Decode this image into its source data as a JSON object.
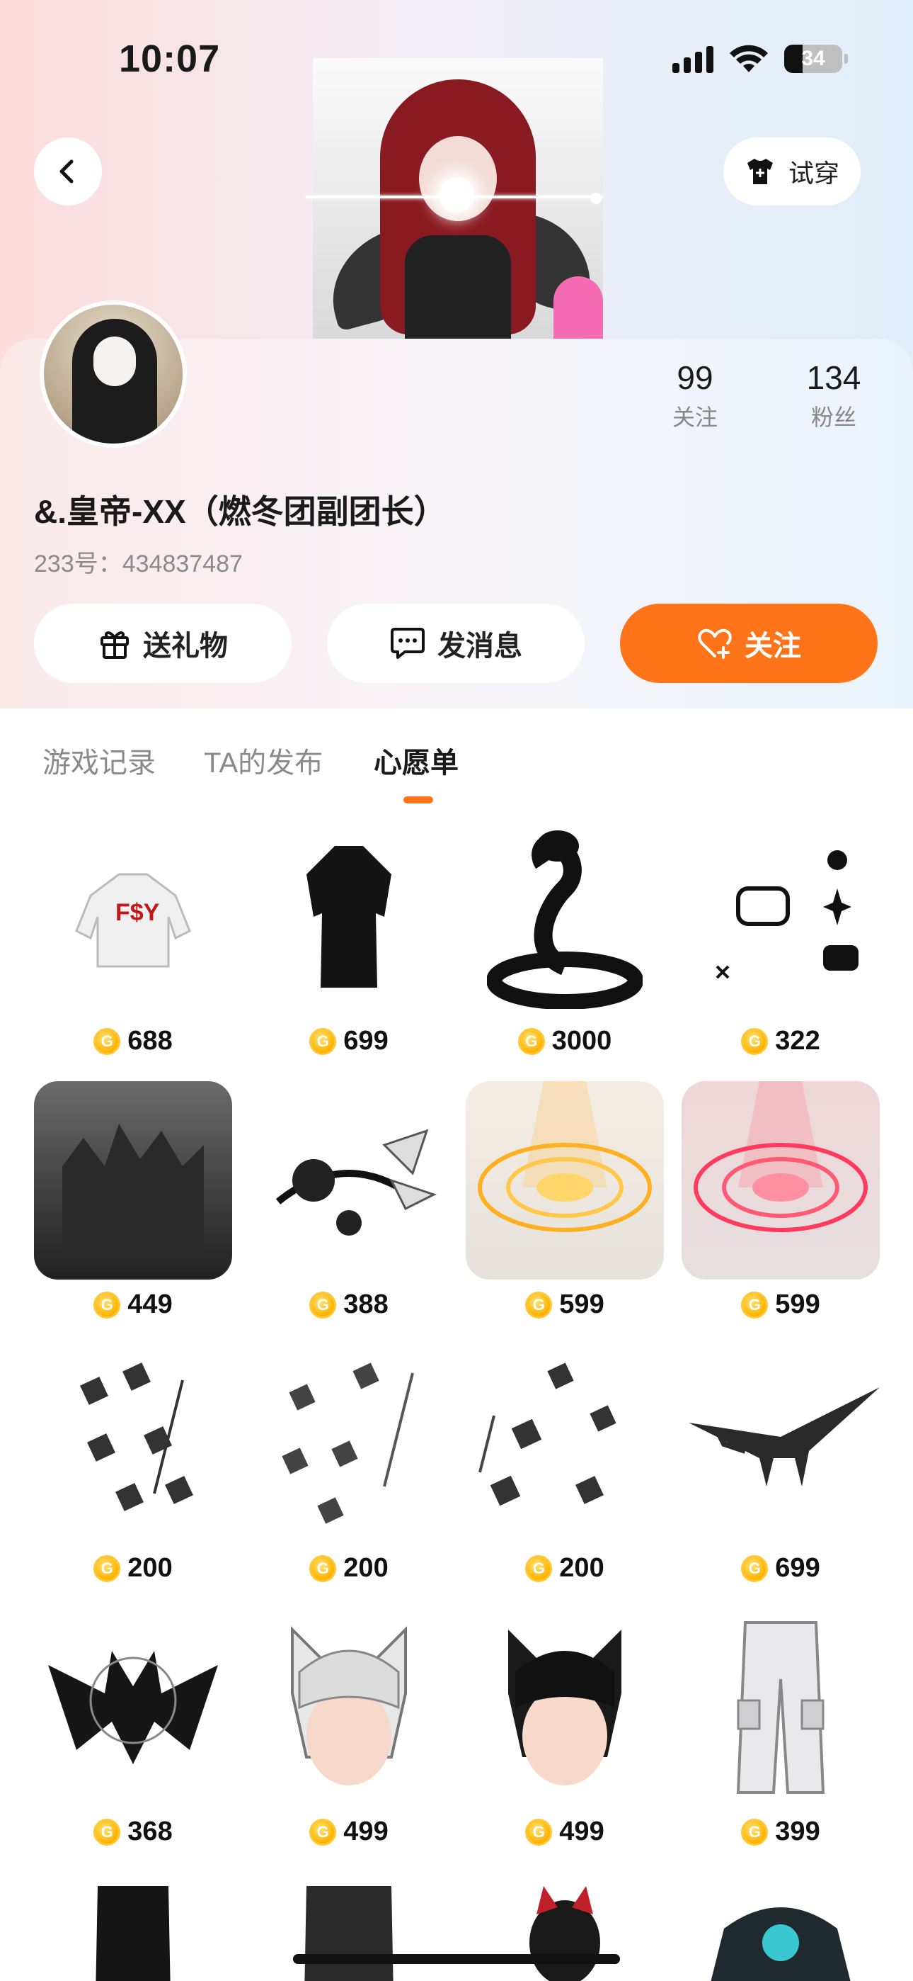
{
  "status_bar": {
    "time": "10:07",
    "battery": "34"
  },
  "header": {
    "try_on_label": "试穿"
  },
  "profile": {
    "nickname": "&.皇帝-XX（燃冬团副团长）",
    "uid": "233号：434837487",
    "following_count": "99",
    "following_label": "关注",
    "fans_count": "134",
    "fans_label": "粉丝"
  },
  "actions": {
    "gift_label": "送礼物",
    "message_label": "发消息",
    "follow_label": "关注"
  },
  "tabs": [
    {
      "label": "游戏记录"
    },
    {
      "label": "TA的发布"
    },
    {
      "label": "心愿单"
    }
  ],
  "wishlist": [
    {
      "name": "white-hoodie",
      "price": "688"
    },
    {
      "name": "black-coat",
      "price": "699"
    },
    {
      "name": "black-cobra",
      "price": "3000"
    },
    {
      "name": "pixel-cat-effect",
      "price": "322"
    },
    {
      "name": "dark-castle-background",
      "price": "449"
    },
    {
      "name": "butterfly-headband",
      "price": "388"
    },
    {
      "name": "gold-magic-circle",
      "price": "599"
    },
    {
      "name": "pink-magic-circle",
      "price": "599"
    },
    {
      "name": "floating-text-effect-1",
      "price": "200"
    },
    {
      "name": "floating-text-effect-2",
      "price": "200"
    },
    {
      "name": "floating-text-effect-3",
      "price": "200"
    },
    {
      "name": "black-pegasus",
      "price": "699"
    },
    {
      "name": "dark-wings-emblem",
      "price": "368"
    },
    {
      "name": "white-cat-ear-hair",
      "price": "499"
    },
    {
      "name": "black-cat-ear-hair",
      "price": "499"
    },
    {
      "name": "cargo-pants",
      "price": "399"
    }
  ],
  "colors": {
    "accent": "#ff7418",
    "coin": "#ffb300"
  }
}
